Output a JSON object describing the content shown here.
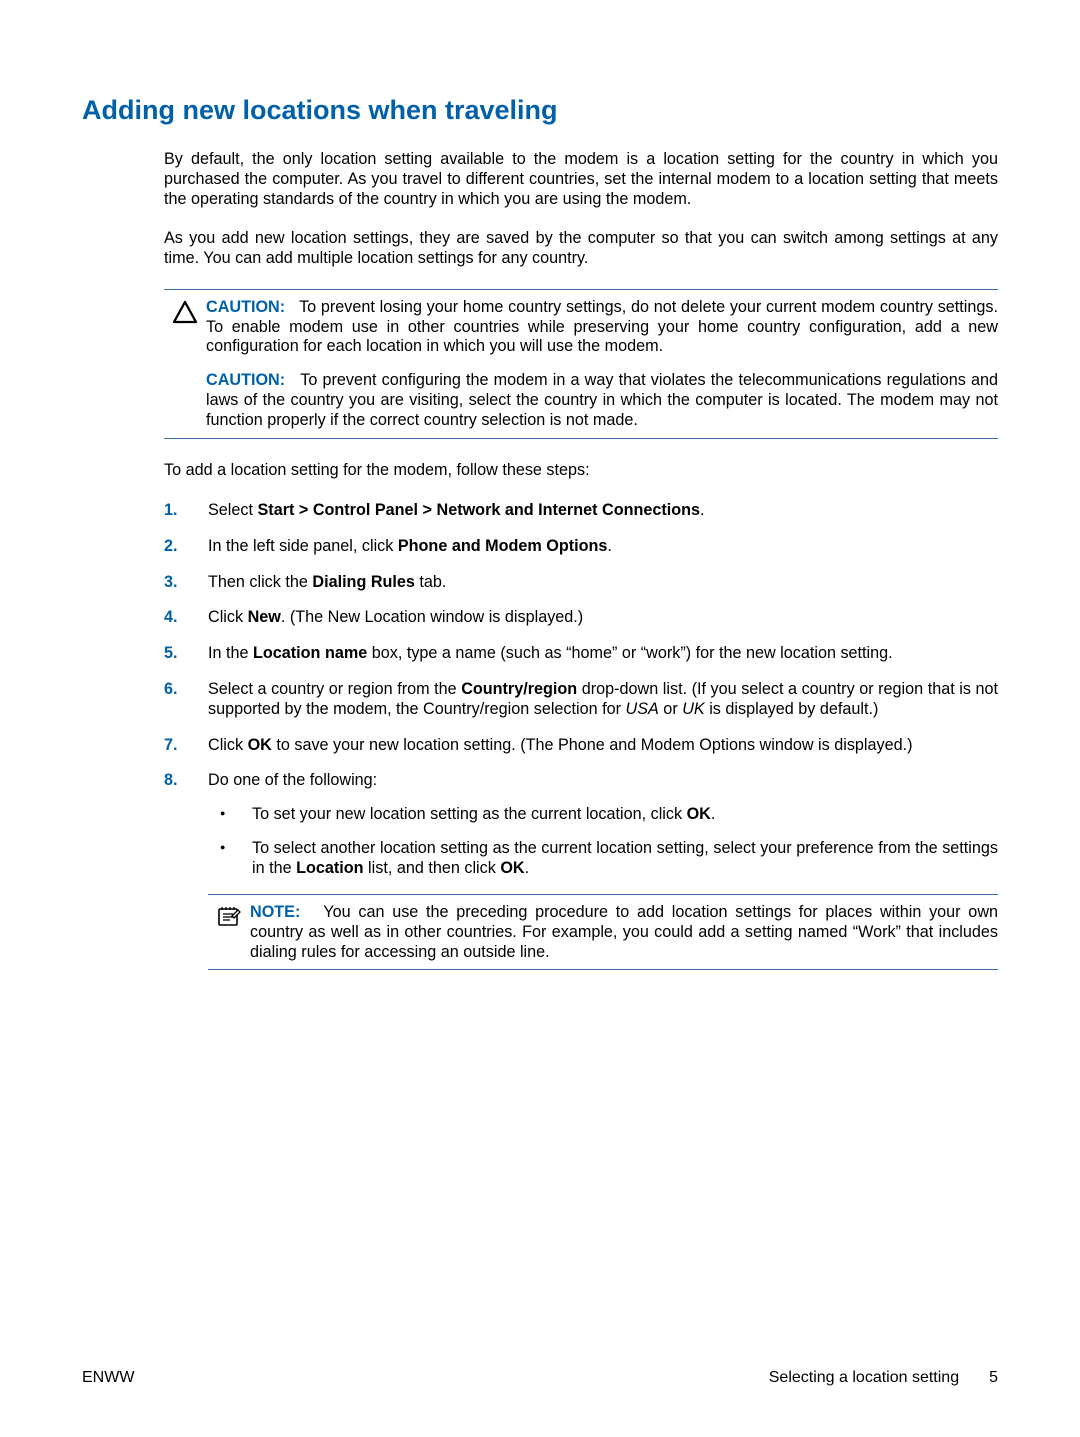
{
  "heading": "Adding new locations when traveling",
  "intro1": "By default, the only location setting available to the modem is a location setting for the country in which you purchased the computer. As you travel to different countries, set the internal modem to a location setting that meets the operating standards of the country in which you are using the modem.",
  "intro2": "As you add new location settings, they are saved by the computer so that you can switch among settings at any time. You can add multiple location settings for any country.",
  "caution": {
    "label": "CAUTION:",
    "c1": "To prevent losing your home country settings, do not delete your current modem country settings. To enable modem use in other countries while preserving your home country configuration, add a new configuration for each location in which you will use the modem.",
    "c2": "To prevent configuring the modem in a way that violates the telecommunications regulations and laws of the country you are visiting, select the country in which the computer is located. The modem may not function properly if the correct country selection is not made."
  },
  "lead": "To add a location setting for the modem, follow these steps:",
  "steps": {
    "s1a": "Select ",
    "s1b": "Start > Control Panel > Network and Internet Connections",
    "s1c": ".",
    "s2a": "In the left side panel, click ",
    "s2b": "Phone and Modem Options",
    "s2c": ".",
    "s3a": "Then click the ",
    "s3b": "Dialing Rules",
    "s3c": " tab.",
    "s4a": "Click ",
    "s4b": "New",
    "s4c": ". (The New Location window is displayed.)",
    "s5a": "In the ",
    "s5b": "Location name",
    "s5c": " box, type a name (such as “home” or “work”) for the new location setting.",
    "s6a": "Select a country or region from the ",
    "s6b": "Country/region",
    "s6c": " drop-down list. (If you select a country or region that is not supported by the modem, the Country/region selection for ",
    "s6d": "USA",
    "s6e": " or ",
    "s6f": "UK",
    "s6g": " is displayed by default.)",
    "s7a": "Click ",
    "s7b": "OK",
    "s7c": " to save your new location setting. (The Phone and Modem Options window is displayed.)",
    "s8": "Do one of the following:",
    "s8_b1a": "To set your new location setting as the current location, click ",
    "s8_b1b": "OK",
    "s8_b1c": ".",
    "s8_b2a": "To select another location setting as the current location setting, select your preference from the settings in the ",
    "s8_b2b": "Location",
    "s8_b2c": " list, and then click ",
    "s8_b2d": "OK",
    "s8_b2e": "."
  },
  "note": {
    "label": "NOTE:",
    "text": "You can use the preceding procedure to add location settings for places within your own country as well as in other countries. For example, you could add a setting named “Work” that includes dialing rules for accessing an outside line."
  },
  "footer": {
    "left": "ENWW",
    "section": "Selecting a location setting",
    "page": "5"
  }
}
